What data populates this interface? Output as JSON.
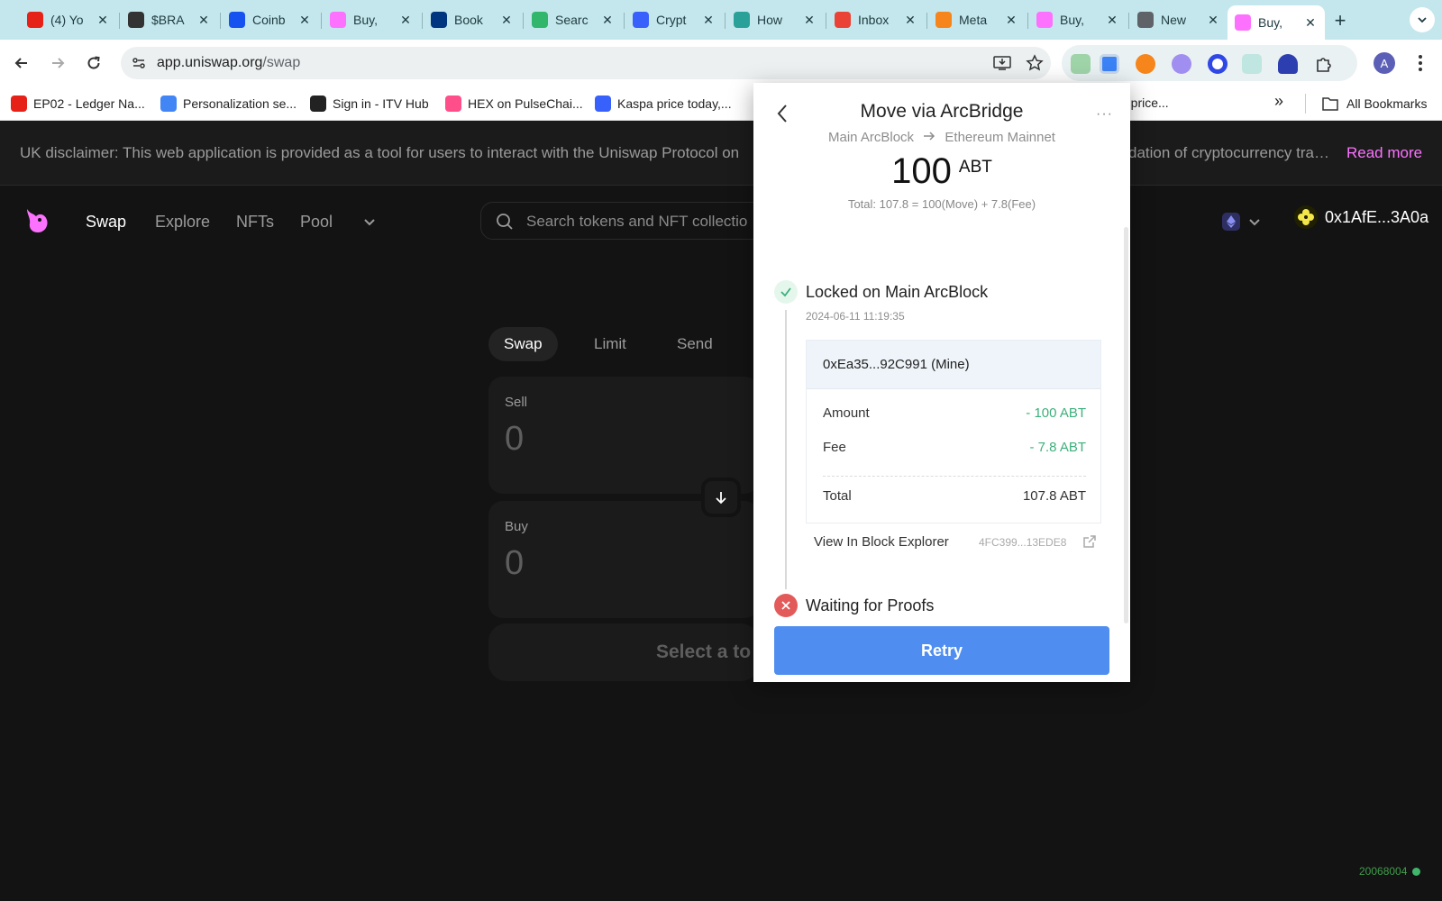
{
  "browser": {
    "tabs": [
      {
        "title": "(4) Yo",
        "icon": "youtube-icon",
        "color": "#e62117"
      },
      {
        "title": "$BRA",
        "icon": "fox-mask-icon",
        "color": "#333333"
      },
      {
        "title": "Coinb",
        "icon": "coinbase-icon",
        "color": "#1652f0"
      },
      {
        "title": "Buy,",
        "icon": "uniswap-icon",
        "color": "#fc72ff"
      },
      {
        "title": "Book",
        "icon": "booking-icon",
        "color": "#003580"
      },
      {
        "title": "Searc",
        "icon": "heart-icon",
        "color": "#31b66b"
      },
      {
        "title": "Crypt",
        "icon": "coinmarketcap-icon",
        "color": "#3861fb"
      },
      {
        "title": "How",
        "icon": "globe-icon",
        "color": "#2aa198"
      },
      {
        "title": "Inbox",
        "icon": "gmail-icon",
        "color": "#ea4335"
      },
      {
        "title": "Meta",
        "icon": "metamask-icon",
        "color": "#f6851b"
      },
      {
        "title": "Buy,",
        "icon": "uniswap-icon",
        "color": "#fc72ff"
      },
      {
        "title": "New",
        "icon": "chrome-icon",
        "color": "#5f6368"
      },
      {
        "title": "Buy,",
        "icon": "uniswap-icon",
        "color": "#fc72ff"
      }
    ],
    "tab_close": "✕",
    "new_tab": "+",
    "url_host": "app.uniswap.org",
    "url_path": "/swap",
    "profile_initial": "A",
    "bookmarks": [
      {
        "label": "EP02 - Ledger Na...",
        "icon": "youtube-icon",
        "color": "#e62117"
      },
      {
        "label": "Personalization se...",
        "icon": "google-icon",
        "color": "#4285f4"
      },
      {
        "label": "Sign in - ITV Hub",
        "icon": "itvx-icon",
        "color": "#222222"
      },
      {
        "label": "HEX on PulseChai...",
        "icon": "hex-icon",
        "color": "#ff4f8b"
      },
      {
        "label": "Kaspa price today,...",
        "icon": "coinmarketcap-icon",
        "color": "#3861fb"
      },
      {
        "label": "bs price...",
        "icon": "",
        "color": "#ffffff"
      }
    ],
    "bookmarks_more": "»",
    "all_bookmarks": "All Bookmarks"
  },
  "uniswap": {
    "disclaimer": "UK disclaimer: This web application is provided as a tool for users to interact with the Uniswap Protocol on",
    "disclaimer_tail": "dation of cryptocurrency tra…",
    "read_more": "Read more",
    "nav": [
      "Swap",
      "Explore",
      "NFTs",
      "Pool"
    ],
    "search_placeholder": "Search tokens and NFT collectio",
    "wallet_address": "0x1AfE...3A0a",
    "swap_tabs": [
      "Swap",
      "Limit",
      "Send"
    ],
    "sell_label": "Sell",
    "sell_value": "0",
    "buy_label": "Buy",
    "buy_value": "0",
    "select_token": "Select a to",
    "build_number": "20068004"
  },
  "modal": {
    "title": "Move via ArcBridge",
    "from_chain": "Main ArcBlock",
    "to_chain": "Ethereum Mainnet",
    "amount": "100",
    "unit": "ABT",
    "total_formula": "Total: 107.8 = 100(Move) + 7.8(Fee)",
    "more": "···",
    "step1": {
      "title": "Locked on Main ArcBlock",
      "time": "2024-06-11 11:19:35",
      "account": "0xEa35...92C991 (Mine)",
      "amount_label": "Amount",
      "amount_value": "- 100 ABT",
      "fee_label": "Fee",
      "fee_value": "- 7.8 ABT",
      "total_label": "Total",
      "total_value": "107.8 ABT",
      "explorer_label": "View In Block Explorer",
      "tx_hash": "4FC399...13EDE8"
    },
    "step2": {
      "title": "Waiting for Proofs"
    },
    "retry_label": "Retry"
  }
}
